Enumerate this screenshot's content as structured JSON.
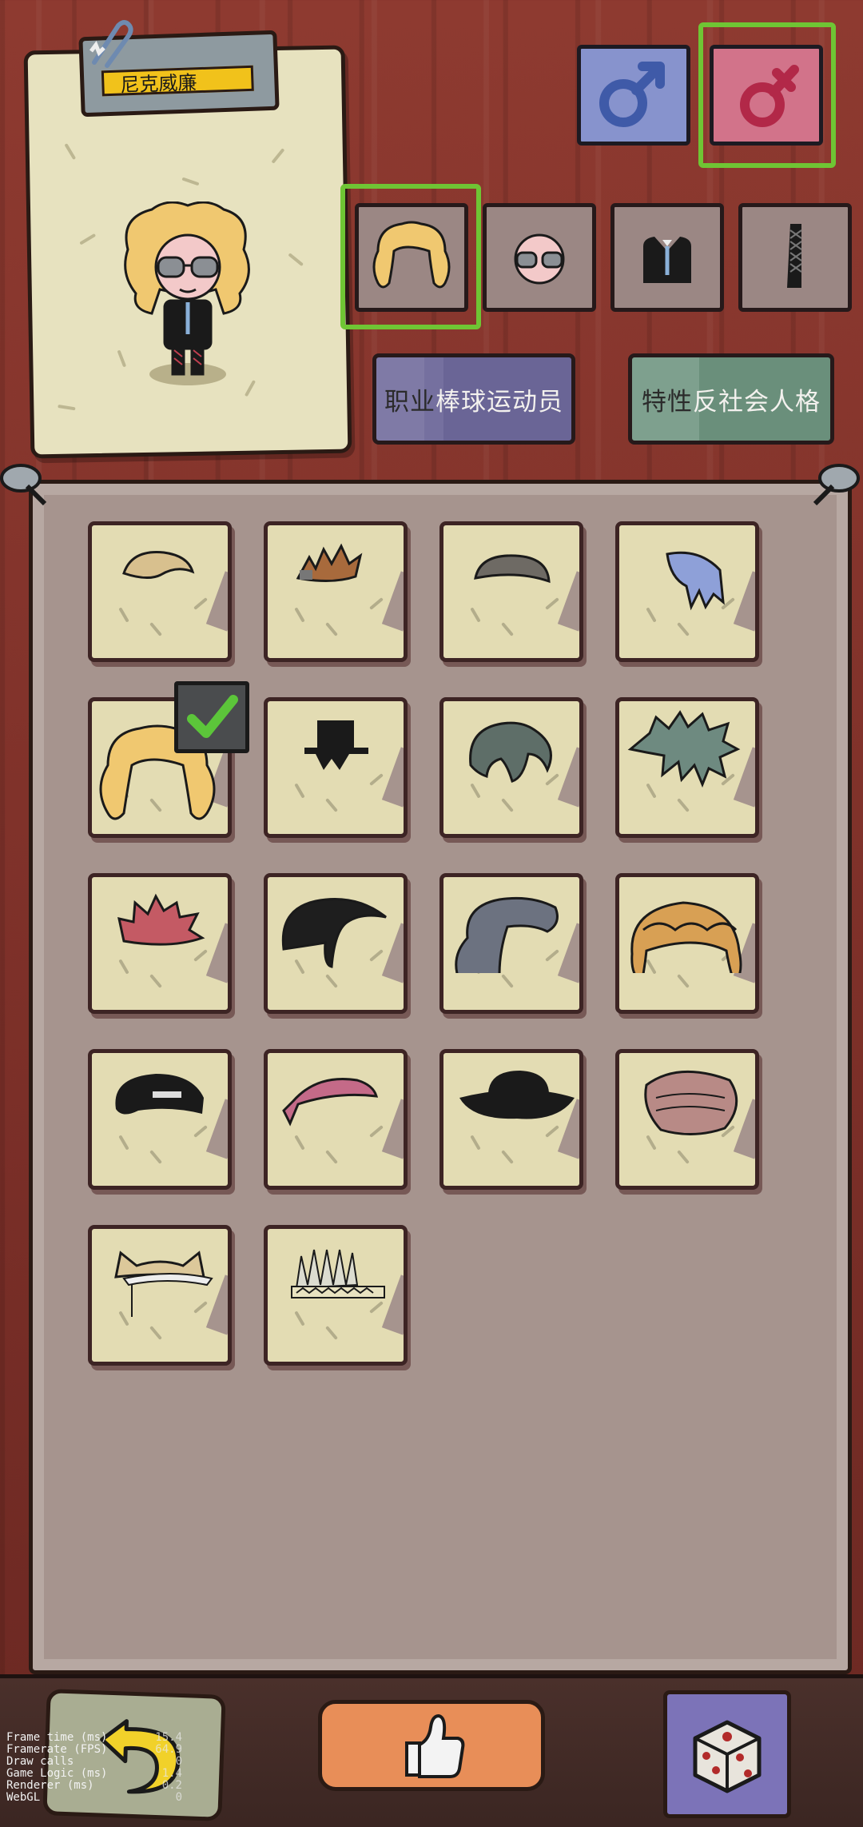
{
  "character": {
    "name": "尼克威廉",
    "selected_gender": "female",
    "profession_label": "职业",
    "profession_value": "棒球运动员",
    "trait_label": "特性",
    "trait_value": "反社会人格"
  },
  "gender_buttons": [
    {
      "id": "male",
      "icon": "mars-symbol",
      "selected": false
    },
    {
      "id": "female",
      "icon": "venus-symbol",
      "selected": true
    }
  ],
  "category_tabs": [
    {
      "id": "hair",
      "icon": "blonde-curly-hair",
      "selected": true
    },
    {
      "id": "face",
      "icon": "face-with-sunglasses",
      "selected": false
    },
    {
      "id": "outfit",
      "icon": "suit-jacket",
      "selected": false
    },
    {
      "id": "legs",
      "icon": "fishnet-leg",
      "selected": false
    }
  ],
  "hair_items": [
    {
      "icon": "blonde-swept-hair",
      "color": "#d8c08e",
      "selected": false
    },
    {
      "icon": "brown-spiky-hair",
      "color": "#a86a3c",
      "selected": false
    },
    {
      "icon": "buzz-cut-hair",
      "color": "#6e6a64",
      "selected": false
    },
    {
      "icon": "blue-long-bangs-hair",
      "color": "#8ea0d8",
      "selected": false
    },
    {
      "icon": "blonde-curly-hair",
      "color": "#f0c870",
      "selected": true
    },
    {
      "icon": "black-top-hat-small",
      "color": "#1a1a1a",
      "selected": false
    },
    {
      "icon": "grey-green-messy-hair",
      "color": "#5e6e68",
      "selected": false
    },
    {
      "icon": "dark-green-spiky-hair",
      "color": "#6e8a80",
      "selected": false
    },
    {
      "icon": "red-spiky-hair",
      "color": "#c45a64",
      "selected": false
    },
    {
      "icon": "black-slick-hair",
      "color": "#1e1e1e",
      "selected": false
    },
    {
      "icon": "grey-wavy-hair",
      "color": "#6c7280",
      "selected": false
    },
    {
      "icon": "golden-braided-hair",
      "color": "#d8a054",
      "selected": false
    },
    {
      "icon": "black-backwards-cap",
      "color": "#1a1a1a",
      "selected": false
    },
    {
      "icon": "pink-bandana",
      "color": "#c46a88",
      "selected": false
    },
    {
      "icon": "black-bowler-hat",
      "color": "#1a1a1a",
      "selected": false
    },
    {
      "icon": "mauve-wrapped-hair",
      "color": "#b88a86",
      "selected": false
    },
    {
      "icon": "cat-ear-headband",
      "color": "#dcc89a",
      "selected": false
    },
    {
      "icon": "feather-headdress",
      "color": "#dcdcd0",
      "selected": false
    }
  ],
  "bottom_buttons": [
    {
      "id": "back",
      "icon": "yellow-back-arrow-icon"
    },
    {
      "id": "confirm",
      "icon": "thumbs-up-icon"
    },
    {
      "id": "random",
      "icon": "dice-icon"
    }
  ],
  "debug": {
    "rows": [
      {
        "label": "Frame time (ms)",
        "value": "15.4"
      },
      {
        "label": "Framerate (FPS)",
        "value": "64.9"
      },
      {
        "label": "Draw calls",
        "value": "0"
      },
      {
        "label": "Game Logic (ms)",
        "value": "1.4"
      },
      {
        "label": "Renderer (ms)",
        "value": "0.2"
      },
      {
        "label": "WebGL",
        "value": "0"
      }
    ]
  },
  "colors": {
    "background": "#7b2f28",
    "board": "#a6948e",
    "selection": "#6fc534",
    "name_field": "#f1c21b"
  }
}
